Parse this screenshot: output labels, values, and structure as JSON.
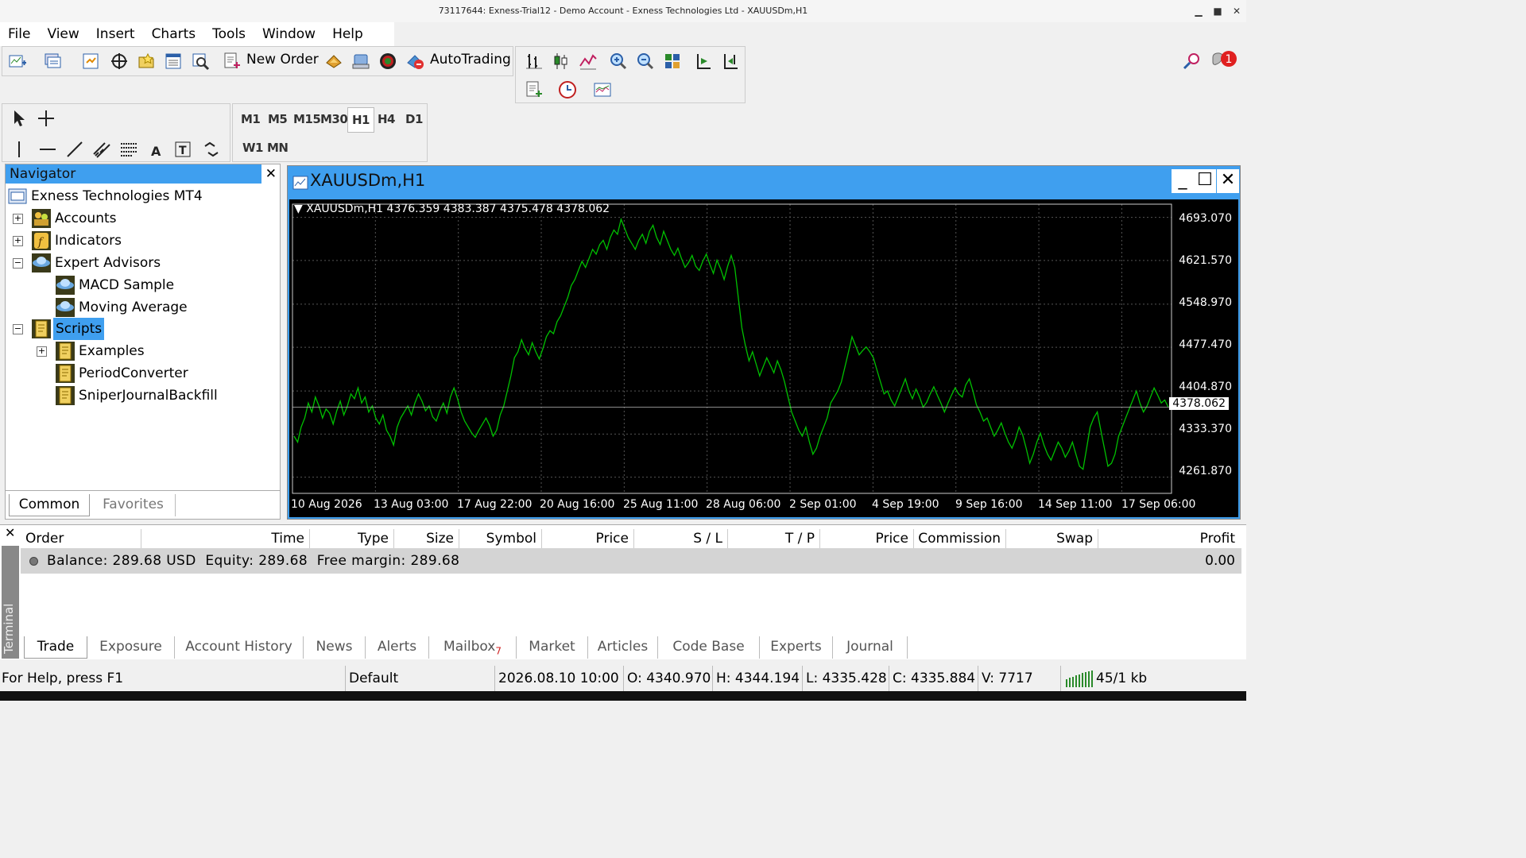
{
  "window": {
    "title": "73117644: Exness-Trial12 - Demo Account - Exness Technologies Ltd - XAUUSDm,H1"
  },
  "menu": [
    "File",
    "View",
    "Insert",
    "Charts",
    "Tools",
    "Window",
    "Help"
  ],
  "toolbar": {
    "new_order_label": "New Order",
    "autotrading_label": "AutoTrading",
    "alerts_count": "1"
  },
  "timeframes": [
    "M1",
    "M5",
    "M15",
    "M30",
    "H1",
    "H4",
    "D1",
    "W1",
    "MN"
  ],
  "active_timeframe": "H1",
  "navigator": {
    "title": "Navigator",
    "root": "Exness Technologies MT4",
    "items": [
      {
        "label": "Accounts",
        "expander": "+"
      },
      {
        "label": "Indicators",
        "expander": "+"
      },
      {
        "label": "Expert Advisors",
        "expander": "−"
      },
      {
        "label": "MACD Sample"
      },
      {
        "label": "Moving Average"
      },
      {
        "label": "Scripts",
        "expander": "−"
      },
      {
        "label": "Examples",
        "expander": "+"
      },
      {
        "label": "PeriodConverter"
      },
      {
        "label": "SniperJournalBackfill"
      }
    ],
    "tabs": [
      "Common",
      "Favorites"
    ]
  },
  "chart": {
    "window_title": "XAUUSDm,H1",
    "info": "XAUUSDm,H1  4376.359 4383.387 4375.478 4378.062",
    "current_price": "4378.062"
  },
  "chart_data": {
    "type": "line",
    "symbol": "XAUUSDm",
    "timeframe": "H1",
    "ohlc_last": {
      "open": 4376.359,
      "high": 4383.387,
      "low": 4375.478,
      "close": 4378.062
    },
    "y_ticks": [
      "4693.070",
      "4621.570",
      "4548.970",
      "4477.470",
      "4404.870",
      "4333.370",
      "4261.870"
    ],
    "x_ticks": [
      "10 Aug 2026",
      "13 Aug 03:00",
      "17 Aug 22:00",
      "20 Aug 16:00",
      "25 Aug 11:00",
      "28 Aug 06:00",
      "2 Sep 01:00",
      "4 Sep 19:00",
      "9 Sep 16:00",
      "14 Sep 11:00",
      "17 Sep 06:00"
    ],
    "ylim": [
      4235,
      4715
    ],
    "series": [
      {
        "values": [
          4330,
          4320,
          4345,
          4360,
          4385,
          4370,
          4395,
          4380,
          4360,
          4375,
          4368,
          4350,
          4372,
          4388,
          4365,
          4380,
          4400,
          4392,
          4410,
          4385,
          4395,
          4370,
          4380,
          4360,
          4350,
          4365,
          4340,
          4330,
          4315,
          4345,
          4360,
          4370,
          4380,
          4365,
          4385,
          4400,
          4388,
          4372,
          4380,
          4362,
          4355,
          4372,
          4385,
          4368,
          4395,
          4410,
          4392,
          4370,
          4355,
          4345,
          4335,
          4328,
          4340,
          4350,
          4360,
          4348,
          4330,
          4340,
          4365,
          4380,
          4405,
          4430,
          4460,
          4470,
          4490,
          4475,
          4465,
          4485,
          4470,
          4458,
          4475,
          4495,
          4505,
          4500,
          4520,
          4530,
          4545,
          4560,
          4580,
          4590,
          4605,
          4620,
          4610,
          4625,
          4640,
          4632,
          4648,
          4655,
          4640,
          4660,
          4672,
          4665,
          4690,
          4675,
          4660,
          4650,
          4640,
          4655,
          4665,
          4650,
          4670,
          4680,
          4660,
          4648,
          4670,
          4655,
          4640,
          4630,
          4642,
          4625,
          4610,
          4618,
          4630,
          4612,
          4605,
          4620,
          4632,
          4615,
          4600,
          4622,
          4608,
          4590,
          4612,
          4630,
          4610,
          4560,
          4510,
          4480,
          4455,
          4470,
          4450,
          4430,
          4445,
          4460,
          4448,
          4435,
          4455,
          4440,
          4420,
          4395,
          4370,
          4355,
          4340,
          4330,
          4345,
          4320,
          4300,
          4310,
          4330,
          4345,
          4360,
          4385,
          4395,
          4405,
          4420,
          4445,
          4470,
          4495,
          4480,
          4465,
          4472,
          4478,
          4470,
          4460,
          4440,
          4420,
          4400,
          4405,
          4390,
          4380,
          4395,
          4410,
          4425,
          4405,
          4392,
          4408,
          4395,
          4378,
          4386,
          4400,
          4412,
          4398,
          4385,
          4370,
          4385,
          4398,
          4410,
          4400,
          4395,
          4415,
          4425,
          4405,
          4382,
          4370,
          4355,
          4360,
          4345,
          4330,
          4340,
          4352,
          4335,
          4320,
          4310,
          4325,
          4345,
          4332,
          4310,
          4285,
          4300,
          4320,
          4335,
          4315,
          4300,
          4290,
          4305,
          4320,
          4310,
          4295,
          4305,
          4320,
          4300,
          4280,
          4275,
          4310,
          4345,
          4360,
          4370,
          4340,
          4310,
          4280,
          4285,
          4300,
          4330,
          4345,
          4360,
          4375,
          4390,
          4405,
          4385,
          4370,
          4380,
          4395,
          4410,
          4398,
          4385,
          4390,
          4378
        ]
      }
    ]
  },
  "terminal": {
    "label": "Terminal",
    "columns": [
      "Order",
      "Time",
      "Type",
      "Size",
      "Symbol",
      "Price",
      "S / L",
      "T / P",
      "Price",
      "Commission",
      "Swap",
      "Profit"
    ],
    "balance_text": "Balance: 289.68 USD  Equity: 289.68  Free margin: 289.68",
    "profit": "0.00",
    "tabs": [
      "Trade",
      "Exposure",
      "Account History",
      "News",
      "Alerts",
      "Mailbox",
      "Market",
      "Articles",
      "Code Base",
      "Experts",
      "Journal"
    ],
    "mailbox_count": "7"
  },
  "statusbar": {
    "help": "For Help, press F1",
    "profile": "Default",
    "datetime": "2026.08.10 10:00",
    "open": "O: 4340.970",
    "high": "H: 4344.194",
    "low": "L: 4335.428",
    "close": "C: 4335.884",
    "volume": "V: 7717",
    "traffic": "45/1 kb"
  },
  "colors": {
    "accent": "#3f9fef",
    "chart_line": "#00c000",
    "chart_bg": "#000000",
    "alert_badge": "#e02020"
  }
}
